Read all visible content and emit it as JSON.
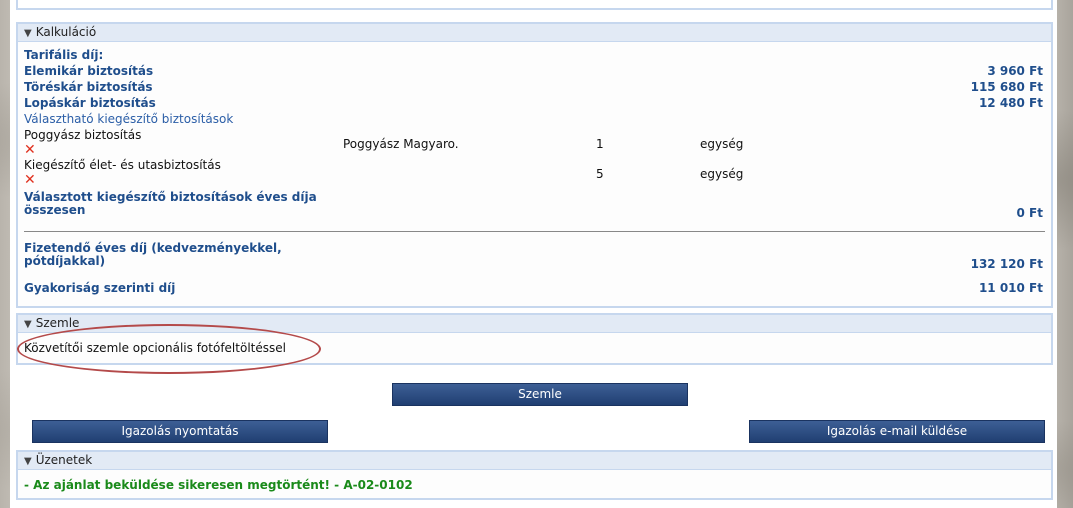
{
  "kalkulacio": {
    "title": "Kalkuláció",
    "tarifalis_label": "Tarifális díj:",
    "elemikar_label": "Elemikár biztosítás",
    "elemikar_value": "3 960 Ft",
    "toreskar_label": "Töréskár biztosítás",
    "toreskar_value": "115 680 Ft",
    "lopaskar_label": "Lopáskár biztosítás",
    "lopaskar_value": "12 480 Ft",
    "valaszthato_label": "Választható kiegészítő biztosítások",
    "extras": [
      {
        "name": "Poggyász biztosítás",
        "option": "Poggyász Magyaro.",
        "qty": "1",
        "unit": "egység"
      },
      {
        "name": "Kiegészítő élet- és utasbiztosítás",
        "option": "",
        "qty": "5",
        "unit": "egység"
      }
    ],
    "valasztott_label": "Választott kiegészítő biztosítások éves díja összesen",
    "valasztott_value": "0 Ft",
    "fizetendo_label": "Fizetendő éves díj (kedvezményekkel, pótdíjakkal)",
    "fizetendo_value": "132 120 Ft",
    "gyakorisag_label": "Gyakoriság szerinti díj",
    "gyakorisag_value": "11 010 Ft"
  },
  "szemle": {
    "title": "Szemle",
    "text": "Közvetítői szemle opcionális fotófeltöltéssel"
  },
  "buttons": {
    "szemle": "Szemle",
    "igazolas_nyomtatas": "Igazolás nyomtatás",
    "igazolas_email": "Igazolás e-mail küldése"
  },
  "uzenetek": {
    "title": "Üzenetek",
    "message": "- Az ajánlat beküldése sikeresen megtörtént! - A-02-0102"
  },
  "colors": {
    "label_blue": "#1f4e8c",
    "button": "#2a4a80",
    "success": "#1a8a1a",
    "delete": "#e0301e"
  }
}
